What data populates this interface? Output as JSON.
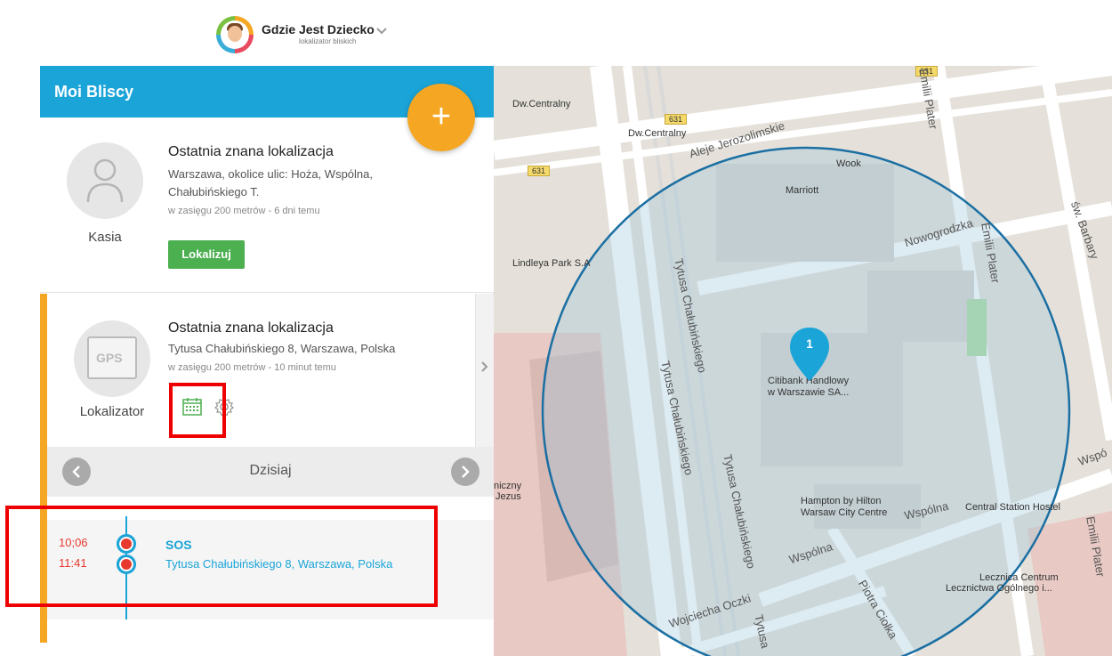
{
  "header": {
    "brand_name": "Gdzie Jest Dziecko",
    "brand_sub": "lokalizator bliskich"
  },
  "panel": {
    "title": "Moi Bliscy",
    "fab_label": "+"
  },
  "contacts": [
    {
      "name": "Kasia",
      "title": "Ostatnia znana lokalizacja",
      "address_line1": "Warszawa, okolice ulic: Hoża, Wspólna,",
      "address_line2": "Chałubińskiego T.",
      "meta": "w zasięgu 200 metrów - 6 dni temu",
      "button": "Lokalizuj"
    },
    {
      "name": "Lokalizator",
      "avatar_text": "GPS",
      "title": "Ostatnia znana lokalizacja",
      "address": "Tytusa Chałubińskiego 8, Warszawa, Polska",
      "meta": "w zasięgu 200 metrów - 10 minut temu"
    }
  ],
  "day_nav": {
    "label": "Dzisiaj"
  },
  "timeline": {
    "times": [
      "10;06",
      "11:41"
    ],
    "title": "SOS",
    "address": "Tytusa Chałubińskiego 8, Warszawa, Polska"
  },
  "map": {
    "pin_label": "1",
    "labels": {
      "dw1": "Dw.Centralny",
      "dw2": "Dw.Centralny",
      "road631a": "631",
      "road631b": "631",
      "road631c": "631",
      "jerozolimskie": "Aleje Jerozolimskie",
      "wook": "Wook",
      "marriott": "Marriott",
      "nowogrodzka": "Nowogrodzka",
      "emilii1": "Emilii Plater",
      "emilii2": "Emilii Plater",
      "emilii3": "Emilii Plater",
      "barbary": "św. Barbary",
      "lindleya": "Lindleya Park S.A",
      "tytusa1": "Tytusa Chałubińskiego",
      "tytusa2": "Tytusa Chałubińskiego",
      "tytusa3": "Tytusa Chałubińskiego",
      "tytusa4": "Tytusa",
      "citibank1": "Citibank Handlowy",
      "citibank2": "w Warszawie SA...",
      "hampton1": "Hampton by Hilton",
      "hampton2": "Warsaw City Centre",
      "wspolna1": "Wspólna",
      "wspolna2": "Wspólna",
      "wspolna3": "Wspó",
      "central_hostel": "Central Station Hostel",
      "piotra": "Piotra Ciołka",
      "wojciecha": "Wojciecha Oczki",
      "lecznica1": "Lecznica Centrum",
      "lecznica2": "Lecznictwa Ogólnego i...",
      "szpital1": "niczny",
      "szpital2": "Jezus"
    },
    "colors": {
      "radius": "#1b6fa3",
      "radius_fill": "#9fc7d9"
    }
  },
  "colors": {
    "primary": "#1aa4d8",
    "accent": "#f5a623",
    "success": "#4caf50",
    "danger": "#e8392f",
    "highlight": "#ee0000"
  }
}
